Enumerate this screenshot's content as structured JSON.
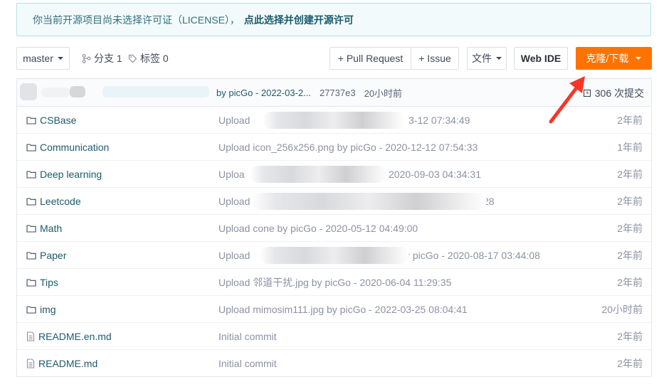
{
  "notice": {
    "text": "你当前开源项目尚未选择许可证（LICENSE），",
    "link": "点此选择并创建开源许可"
  },
  "toolbar": {
    "branch": "master",
    "branches_label": "分支 1",
    "tags_label": "标签 0",
    "pull_request": "+ Pull Request",
    "issue": "+ Issue",
    "files": "文件",
    "web_ide": "Web IDE",
    "clone": "克隆/下载"
  },
  "latest_commit": {
    "by": "by picGo - 2022-03-2...",
    "hash": "27737e3",
    "time": "20小时前",
    "count": "306 次提交"
  },
  "files": [
    {
      "type": "folder",
      "name": "CSBase",
      "msg_left": "Upload ",
      "msg_right": "3-12 07:34:49",
      "age": "2年前"
    },
    {
      "type": "folder",
      "name": "Communication",
      "msg_left": "Upload icon_256x256.png by picGo - 2020-12-12 07:54:33",
      "msg_right": "",
      "age": "1年前"
    },
    {
      "type": "folder",
      "name": "Deep learning",
      "msg_left": "Uploa",
      "msg_right": "2020-09-03 04:34:31",
      "age": "2年前"
    },
    {
      "type": "folder",
      "name": "Leetcode",
      "msg_left": "Upload ",
      "msg_right": "28",
      "age": "2年前"
    },
    {
      "type": "folder",
      "name": "Math",
      "msg_left": "Upload cone by picGo - 2020-05-12 04:49:00",
      "msg_right": "",
      "age": "2年前"
    },
    {
      "type": "folder",
      "name": "Paper",
      "msg_left": "Upload ",
      "msg_right": "y picGo - 2020-08-17 03:44:08",
      "age": "2年前"
    },
    {
      "type": "folder",
      "name": "Tips",
      "msg_left": "Upload 邻道干扰.jpg by picGo - 2020-06-04 11:29:35",
      "msg_right": "",
      "age": "2年前"
    },
    {
      "type": "folder",
      "name": "img",
      "msg_left": "Upload mimosim111.jpg by picGo - 2022-03-25 08:04:41",
      "msg_right": "",
      "age": "20小时前"
    },
    {
      "type": "file",
      "name": "README.en.md",
      "msg_left": "Initial commit",
      "msg_right": "",
      "age": "2年前"
    },
    {
      "type": "file",
      "name": "README.md",
      "msg_left": "Initial commit",
      "msg_right": "",
      "age": "2年前"
    }
  ],
  "colors": {
    "accent": "#fe7300",
    "link": "#1c5a6c",
    "annotation_arrow": "#f5372a"
  }
}
